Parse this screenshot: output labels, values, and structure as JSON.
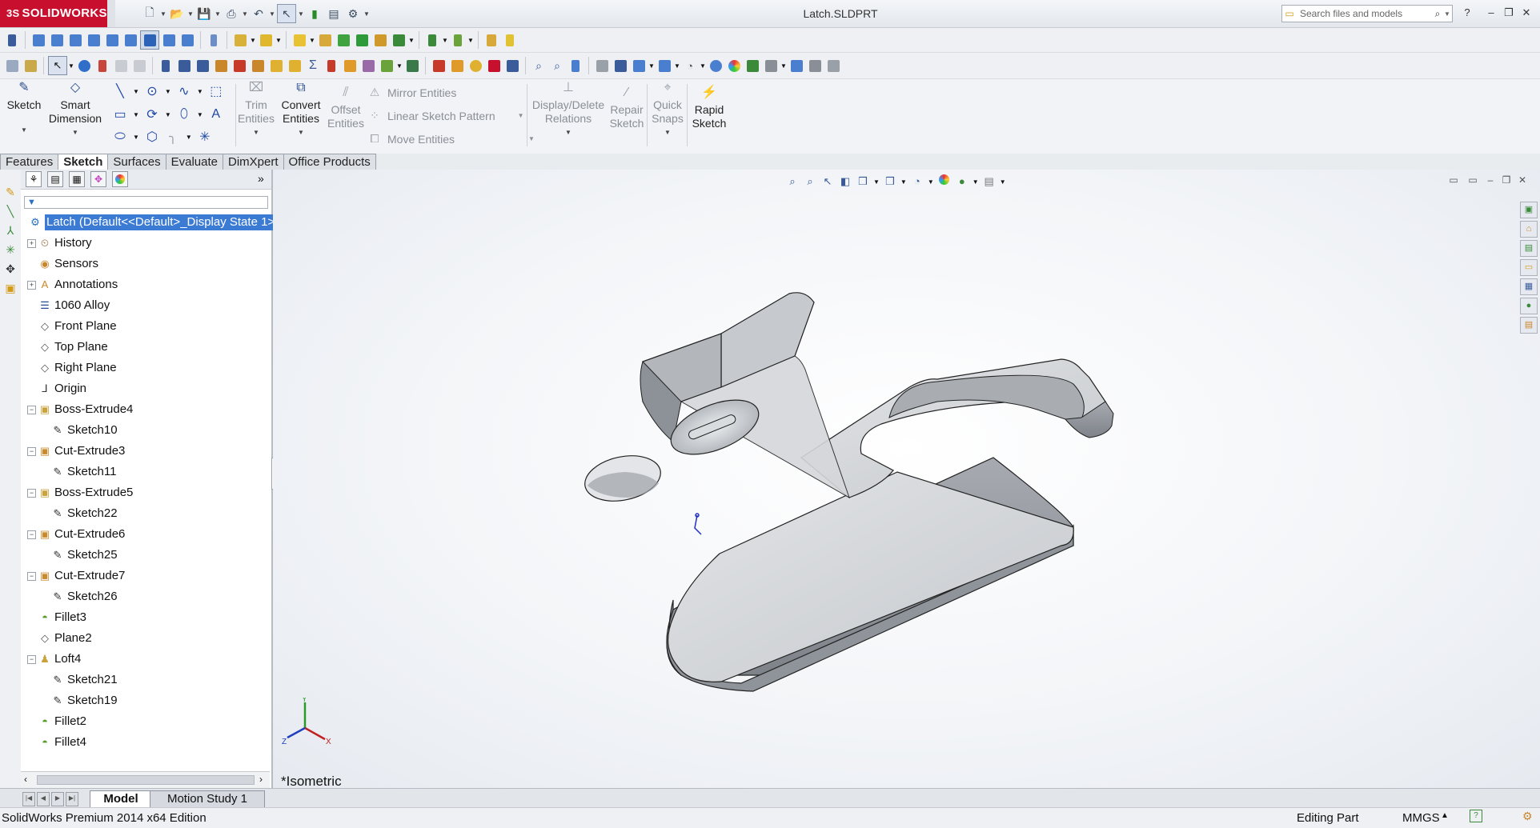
{
  "app": {
    "logo_text": "SOLIDWORKS",
    "logo_mark": "3S",
    "document_title": "Latch.SLDPRT",
    "search_placeholder": "Search files and models",
    "brand_color": "#c8102e",
    "accent_color": "#3b7bd4"
  },
  "title_toolbar": {
    "icons": [
      "new-document-icon",
      "open-icon",
      "save-icon",
      "print-icon",
      "undo-icon",
      "select-icon",
      "rebuild-icon",
      "file-properties-icon",
      "options-icon"
    ]
  },
  "window_controls": {
    "help": "?",
    "minimize": "–",
    "restore": "❐",
    "close": "✕"
  },
  "command_manager": {
    "sketch": "Sketch",
    "smart_dimension_1": "Smart",
    "smart_dimension_2": "Dimension",
    "trim_1": "Trim",
    "trim_2": "Entities",
    "convert_1": "Convert",
    "convert_2": "Entities",
    "offset_1": "Offset",
    "offset_2": "Entities",
    "mirror": "Mirror Entities",
    "linear_pattern": "Linear Sketch Pattern",
    "move": "Move Entities",
    "display_delete_1": "Display/Delete",
    "display_delete_2": "Relations",
    "repair_1": "Repair",
    "repair_2": "Sketch",
    "quick_snaps_1": "Quick",
    "quick_snaps_2": "Snaps",
    "rapid_1": "Rapid",
    "rapid_2": "Sketch"
  },
  "tabs": [
    "Features",
    "Sketch",
    "Surfaces",
    "Evaluate",
    "DimXpert",
    "Office Products"
  ],
  "active_tab": "Sketch",
  "feature_tree": [
    {
      "label": "Latch  (Default<<Default>_Display State 1>)",
      "icon": "part-icon",
      "indent": 0,
      "expander": "",
      "root": true
    },
    {
      "label": "History",
      "icon": "history-icon",
      "indent": 1,
      "expander": "+"
    },
    {
      "label": "Sensors",
      "icon": "sensors-icon",
      "indent": 1,
      "expander": ""
    },
    {
      "label": "Annotations",
      "icon": "annotations-icon",
      "indent": 1,
      "expander": "+"
    },
    {
      "label": "1060 Alloy",
      "icon": "material-icon",
      "indent": 1,
      "expander": ""
    },
    {
      "label": "Front Plane",
      "icon": "plane-icon",
      "indent": 1,
      "expander": ""
    },
    {
      "label": "Top Plane",
      "icon": "plane-icon",
      "indent": 1,
      "expander": ""
    },
    {
      "label": "Right Plane",
      "icon": "plane-icon",
      "indent": 1,
      "expander": ""
    },
    {
      "label": "Origin",
      "icon": "origin-icon",
      "indent": 1,
      "expander": ""
    },
    {
      "label": "Boss-Extrude4",
      "icon": "boss-extrude-icon",
      "indent": 1,
      "expander": "−"
    },
    {
      "label": "Sketch10",
      "icon": "sketch-icon",
      "indent": 2,
      "expander": ""
    },
    {
      "label": "Cut-Extrude3",
      "icon": "cut-extrude-icon",
      "indent": 1,
      "expander": "−"
    },
    {
      "label": "Sketch11",
      "icon": "sketch-icon",
      "indent": 2,
      "expander": ""
    },
    {
      "label": "Boss-Extrude5",
      "icon": "boss-extrude-icon",
      "indent": 1,
      "expander": "−"
    },
    {
      "label": "Sketch22",
      "icon": "sketch-icon",
      "indent": 2,
      "expander": ""
    },
    {
      "label": "Cut-Extrude6",
      "icon": "cut-extrude-icon",
      "indent": 1,
      "expander": "−"
    },
    {
      "label": "Sketch25",
      "icon": "sketch-icon",
      "indent": 2,
      "expander": ""
    },
    {
      "label": "Cut-Extrude7",
      "icon": "cut-extrude-icon",
      "indent": 1,
      "expander": "−"
    },
    {
      "label": "Sketch26",
      "icon": "sketch-icon",
      "indent": 2,
      "expander": ""
    },
    {
      "label": "Fillet3",
      "icon": "fillet-icon",
      "indent": 1,
      "expander": ""
    },
    {
      "label": "Plane2",
      "icon": "plane-icon",
      "indent": 1,
      "expander": ""
    },
    {
      "label": "Loft4",
      "icon": "loft-icon",
      "indent": 1,
      "expander": "−"
    },
    {
      "label": "Sketch21",
      "icon": "sketch-icon",
      "indent": 2,
      "expander": ""
    },
    {
      "label": "Sketch19",
      "icon": "sketch-icon",
      "indent": 2,
      "expander": ""
    },
    {
      "label": "Fillet2",
      "icon": "fillet-icon",
      "indent": 1,
      "expander": ""
    },
    {
      "label": "Fillet4",
      "icon": "fillet-icon",
      "indent": 1,
      "expander": ""
    }
  ],
  "viewport": {
    "view_name": "*Isometric",
    "triad_labels": {
      "y": "Y",
      "x": "X",
      "z": "Z"
    }
  },
  "bottom_tabs": [
    "Model",
    "Motion Study 1"
  ],
  "active_bottom_tab": "Model",
  "status": {
    "edition": "SolidWorks Premium 2014 x64 Edition",
    "mode": "Editing Part",
    "units": "MMGS"
  }
}
